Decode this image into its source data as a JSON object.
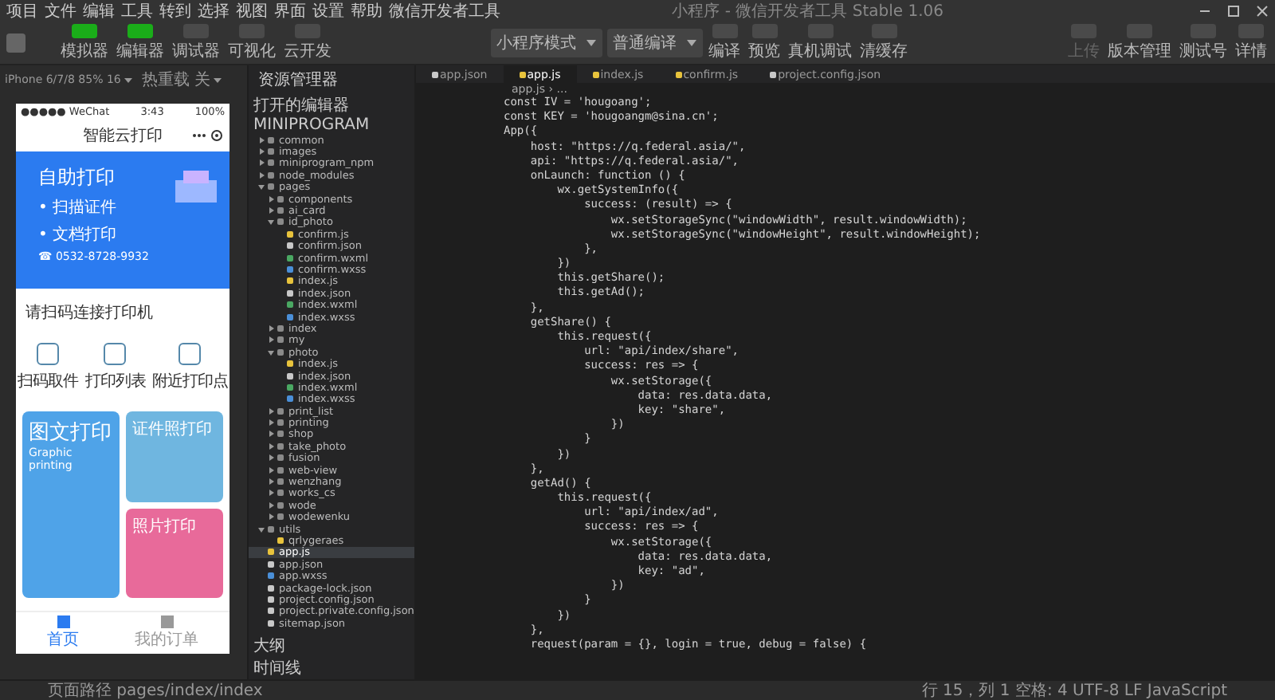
{
  "window": {
    "title": "小程序 - 微信开发者工具 Stable 1.06"
  },
  "menu": [
    "项目",
    "文件",
    "编辑",
    "工具",
    "转到",
    "选择",
    "视图",
    "界面",
    "设置",
    "帮助",
    "微信开发者工具"
  ],
  "toolbar": {
    "mode_buttons": [
      {
        "label": "模拟器",
        "selected": true
      },
      {
        "label": "编辑器",
        "selected": true
      },
      {
        "label": "调试器",
        "selected": false
      },
      {
        "label": "可视化",
        "selected": false
      },
      {
        "label": "云开发",
        "selected": false
      }
    ],
    "mode_select": "小程序模式",
    "compile_select": "普通编译",
    "actions": [
      "编译",
      "预览",
      "真机调试",
      "清缓存"
    ],
    "right_actions": [
      {
        "label": "上传",
        "disabled": true
      },
      {
        "label": "版本管理",
        "disabled": false
      },
      {
        "label": "测试号",
        "disabled": false
      },
      {
        "label": "详情",
        "disabled": false
      }
    ]
  },
  "simulator": {
    "device": "iPhone 6/7/8 85% 16",
    "reload": "热重载 关",
    "phone": {
      "carrier": "●●●●● WeChat",
      "time": "3:43",
      "battery": "100%",
      "title": "智能云打印",
      "banner": {
        "heading": "自助打印",
        "points": [
          "• 扫描证件",
          "• 文档打印"
        ],
        "phone": "☎ 0532-8728-9932"
      },
      "notice": "请扫码连接打印机",
      "grid": [
        "扫码取件",
        "打印列表",
        "附近打印点"
      ],
      "cards": [
        {
          "title": "图文打印",
          "subtitle": "Graphic printing",
          "color": "#4fa3e8"
        },
        {
          "title": "证件照打印",
          "color": "#6fb6e0"
        },
        {
          "title": "照片打印",
          "color": "#e86a9a"
        }
      ],
      "tabs": [
        {
          "label": "首页",
          "selected": true
        },
        {
          "label": "我的订单",
          "selected": false
        }
      ]
    }
  },
  "explorer": {
    "title": "资源管理器",
    "sections": [
      "打开的编辑器",
      "MINIPROGRAM"
    ],
    "tree": [
      {
        "name": "common",
        "kind": "folder",
        "expanded": false,
        "selected": false
      },
      {
        "name": "images",
        "kind": "folder",
        "expanded": false,
        "selected": false
      },
      {
        "name": "miniprogram_npm",
        "kind": "folder",
        "expanded": false,
        "selected": false
      },
      {
        "name": "node_modules",
        "kind": "folder",
        "expanded": false,
        "selected": false
      },
      {
        "name": "pages",
        "kind": "folder",
        "expanded": true,
        "selected": false,
        "children": [
          {
            "name": "components",
            "kind": "folder",
            "expanded": false,
            "selected": false
          },
          {
            "name": "ai_card",
            "kind": "folder",
            "expanded": false,
            "selected": false
          },
          {
            "name": "id_photo",
            "kind": "folder",
            "expanded": true,
            "selected": false,
            "children": [
              {
                "name": "confirm.js",
                "kind": "js",
                "selected": false
              },
              {
                "name": "confirm.json",
                "kind": "json",
                "selected": false
              },
              {
                "name": "confirm.wxml",
                "kind": "wxml",
                "selected": false
              },
              {
                "name": "confirm.wxss",
                "kind": "wxss",
                "selected": false
              },
              {
                "name": "index.js",
                "kind": "js",
                "selected": false
              },
              {
                "name": "index.json",
                "kind": "json",
                "selected": false
              },
              {
                "name": "index.wxml",
                "kind": "wxml",
                "selected": false
              },
              {
                "name": "index.wxss",
                "kind": "wxss",
                "selected": false
              }
            ]
          },
          {
            "name": "index",
            "kind": "folder",
            "expanded": false,
            "selected": false
          },
          {
            "name": "my",
            "kind": "folder",
            "expanded": false,
            "selected": false
          },
          {
            "name": "photo",
            "kind": "folder",
            "expanded": true,
            "selected": false,
            "children": [
              {
                "name": "index.js",
                "kind": "js",
                "selected": false
              },
              {
                "name": "index.json",
                "kind": "json",
                "selected": false
              },
              {
                "name": "index.wxml",
                "kind": "wxml",
                "selected": false
              },
              {
                "name": "index.wxss",
                "kind": "wxss",
                "selected": false
              }
            ]
          },
          {
            "name": "print_list",
            "kind": "folder",
            "expanded": false,
            "selected": false
          },
          {
            "name": "printing",
            "kind": "folder",
            "expanded": false,
            "selected": false
          },
          {
            "name": "shop",
            "kind": "folder",
            "expanded": false,
            "selected": false
          },
          {
            "name": "take_photo",
            "kind": "folder",
            "expanded": false,
            "selected": false
          },
          {
            "name": "fusion",
            "kind": "folder",
            "expanded": false,
            "selected": false
          },
          {
            "name": "web-view",
            "kind": "folder",
            "expanded": false,
            "selected": false
          },
          {
            "name": "wenzhang",
            "kind": "folder",
            "expanded": false,
            "selected": false
          },
          {
            "name": "works_cs",
            "kind": "folder",
            "expanded": false,
            "selected": false
          },
          {
            "name": "wode",
            "kind": "folder",
            "expanded": false,
            "selected": false
          },
          {
            "name": "wodewenku",
            "kind": "folder",
            "expanded": false,
            "selected": false
          }
        ]
      },
      {
        "name": "utils",
        "kind": "folder",
        "expanded": true,
        "selected": false,
        "children": [
          {
            "name": "qrlygeraes",
            "kind": "js",
            "selected": false
          }
        ]
      },
      {
        "name": "app.js",
        "kind": "js",
        "selected": true
      },
      {
        "name": "app.json",
        "kind": "json",
        "selected": false
      },
      {
        "name": "app.wxss",
        "kind": "wxss",
        "selected": false
      },
      {
        "name": "package-lock.json",
        "kind": "json",
        "selected": false
      },
      {
        "name": "project.config.json",
        "kind": "json",
        "selected": false
      },
      {
        "name": "project.private.config.json",
        "kind": "json",
        "selected": false
      },
      {
        "name": "sitemap.json",
        "kind": "json",
        "selected": false
      }
    ],
    "footer": [
      "大纲",
      "时间线"
    ]
  },
  "editor": {
    "tabs": [
      {
        "label": "app.json",
        "kind": "json",
        "selected": false
      },
      {
        "label": "app.js",
        "kind": "js",
        "selected": true
      },
      {
        "label": "index.js",
        "kind": "js",
        "selected": false
      },
      {
        "label": "confirm.js",
        "kind": "js",
        "selected": false
      },
      {
        "label": "project.config.json",
        "kind": "json",
        "selected": false
      }
    ],
    "breadcrumb": "app.js › ...",
    "lines": [
      "const IV = 'hougoang';",
      "const KEY = 'hougoangm@sina.cn';",
      "App({",
      "    host: \"https://q.federal.asia/\",",
      "    api: \"https://q.federal.asia/\",",
      "    onLaunch: function () {",
      "        wx.getSystemInfo({",
      "            success: (result) => {",
      "                wx.setStorageSync(\"windowWidth\", result.windowWidth);",
      "                wx.setStorageSync(\"windowHeight\", result.windowHeight);",
      "            },",
      "        })",
      "        this.getShare();",
      "        this.getAd();",
      "    },",
      "    getShare() {",
      "        this.request({",
      "            url: \"api/index/share\",",
      "            success: res => {",
      "                wx.setStorage({",
      "                    data: res.data.data,",
      "                    key: \"share\",",
      "                })",
      "            }",
      "        })",
      "    },",
      "    getAd() {",
      "        this.request({",
      "            url: \"api/index/ad\",",
      "            success: res => {",
      "                wx.setStorage({",
      "                    data: res.data.data,",
      "                    key: \"ad\",",
      "                })",
      "            }",
      "        })",
      "    },",
      "    request(param = {}, login = true, debug = false) {"
    ]
  },
  "status_bar": {
    "left": "页面路径 pages/index/index",
    "right": "行 15，列 1   空格: 4   UTF-8   LF   JavaScript"
  }
}
